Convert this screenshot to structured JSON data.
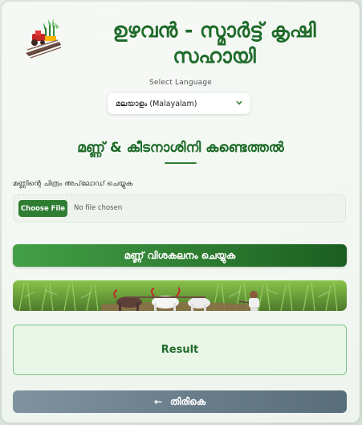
{
  "header": {
    "title_line1": "ഉഴവൻ - സ്മാർട്ട് കൃഷി",
    "title_line2": "സഹായി"
  },
  "language": {
    "label": "Select Language",
    "selected": "മലയാളം (Malayalam)"
  },
  "section": {
    "title": "മണ്ണ് & കീടനാശിനി കണ്ടെത്തൽ"
  },
  "upload": {
    "label": "മണ്ണിന്റെ ചിത്രം അപ്‌ലോഡ് ചെയ്യുക",
    "button": "Choose File",
    "status": "No file chosen"
  },
  "analyze_button": "മണ്ണ് വിശകലനം ചെയ്യുക",
  "result": {
    "label": "Result"
  },
  "back_button": {
    "arrow": "←",
    "label": "തിരികെ"
  },
  "icons": {
    "logo": "farm-logo-icon",
    "dropdown": "chevron-down-icon",
    "back": "arrow-left-icon"
  },
  "colors": {
    "primary_green": "#2e7d32",
    "title_green": "#1f6b2a",
    "back_button": "#6b7e8c",
    "result_border": "#7cc383"
  }
}
